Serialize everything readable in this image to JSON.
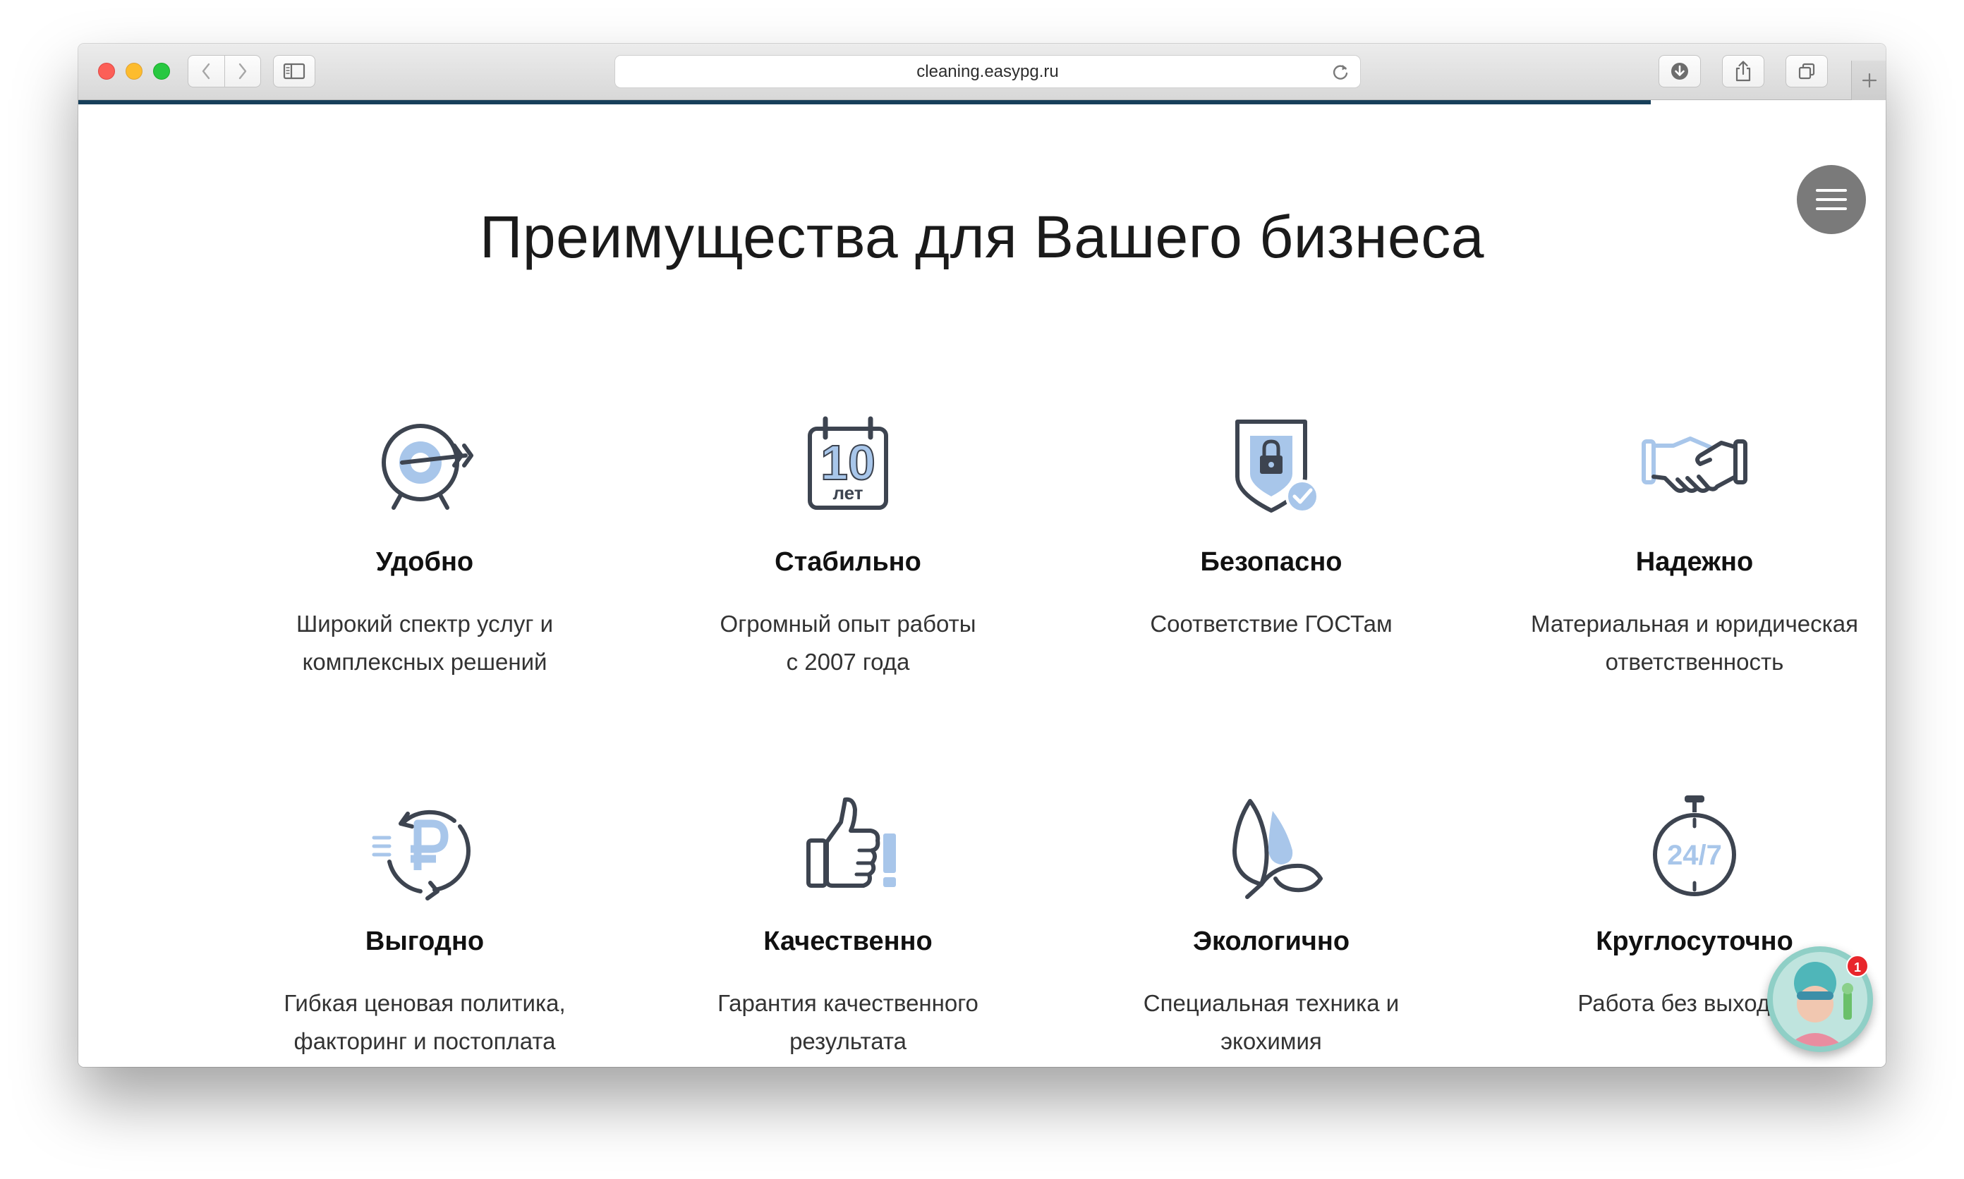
{
  "browser": {
    "url": "cleaning.easypg.ru",
    "load_progress_percent": 87,
    "icons": {
      "back": "chevron-left-icon",
      "forward": "chevron-right-icon",
      "sidebar": "sidebar-icon",
      "reload": "reload-icon",
      "download": "download-icon",
      "share": "share-icon",
      "tabs": "tabs-icon",
      "new_tab": "plus-icon"
    }
  },
  "page": {
    "heading": "Преимущества для Вашего бизнеса",
    "colors": {
      "icon_dark": "#3d4450",
      "icon_accent": "#a8c6ea",
      "menu_button": "#7a7a7a",
      "progress": "#173f5a"
    },
    "features": [
      {
        "icon": "target-icon",
        "title": "Удобно",
        "desc_lines": [
          "Широкий спектр услуг и",
          "комплексных решений"
        ]
      },
      {
        "icon": "calendar-10-years-icon",
        "icon_number": "10",
        "icon_text": "лет",
        "title": "Стабильно",
        "desc_lines": [
          "Огромный опыт работы",
          "с 2007 года"
        ]
      },
      {
        "icon": "shield-lock-icon",
        "title": "Безопасно",
        "desc_lines": [
          "Соответствие ГОСТам"
        ]
      },
      {
        "icon": "handshake-icon",
        "title": "Надежно",
        "desc_lines": [
          "Материальная и юридическая",
          "ответственность"
        ]
      },
      {
        "icon": "ruble-exchange-icon",
        "title": "Выгодно",
        "desc_lines": [
          "Гибкая ценовая политика,",
          "факторинг и постоплата"
        ]
      },
      {
        "icon": "thumbs-up-icon",
        "title": "Качественно",
        "desc_lines": [
          "Гарантия качественного",
          "результата"
        ]
      },
      {
        "icon": "eco-leaf-icon",
        "title": "Экологично",
        "desc_lines": [
          "Специальная техника и",
          "экохимия"
        ]
      },
      {
        "icon": "stopwatch-24-7-icon",
        "icon_text": "24/7",
        "title": "Круглосуточно",
        "desc_lines": [
          "Работа без выходных"
        ]
      }
    ]
  },
  "chat_widget": {
    "icon": "chat-avatar-icon",
    "badge_count": "1"
  }
}
